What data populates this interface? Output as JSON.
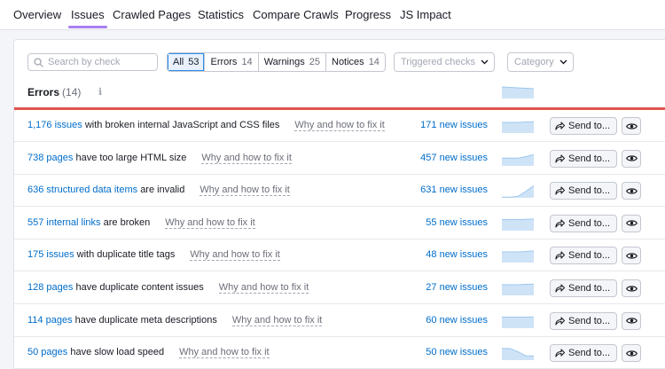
{
  "tabs": [
    {
      "label": "Overview",
      "active": false
    },
    {
      "label": "Issues",
      "active": true
    },
    {
      "label": "Crawled Pages",
      "active": false
    },
    {
      "label": "Statistics",
      "active": false
    },
    {
      "label": "Compare Crawls",
      "active": false
    },
    {
      "label": "Progress",
      "active": false
    },
    {
      "label": "JS Impact",
      "active": false
    }
  ],
  "search": {
    "placeholder": "Search by check"
  },
  "filters": [
    {
      "label": "All",
      "count": "53",
      "active": true
    },
    {
      "label": "Errors",
      "count": "14",
      "active": false
    },
    {
      "label": "Warnings",
      "count": "25",
      "active": false
    },
    {
      "label": "Notices",
      "count": "14",
      "active": false
    }
  ],
  "dropdowns": {
    "triggered": "Triggered checks",
    "category": "Category"
  },
  "section": {
    "title": "Errors",
    "count": "(14)",
    "info_icon": "info-icon"
  },
  "colors": {
    "accent_underline": "#a97ff2",
    "error_line": "#e0534d",
    "link": "#006dca",
    "spark_fill": "#cfe3f7",
    "spark_line": "#9ec8ee"
  },
  "row_buttons": {
    "send_label": "Send to...",
    "send_icon": "share-arrow-icon",
    "eye_icon": "eye-icon"
  },
  "rows": [
    {
      "link": "1,176 issues",
      "text": "with broken internal JavaScript and CSS files",
      "why": "Why and how to fix it",
      "new_issues": "171 new issues",
      "trend": [
        0.75,
        0.75,
        0.75,
        0.78,
        0.8
      ]
    },
    {
      "link": "738 pages",
      "text": "have too large HTML size",
      "why": "Why and how to fix it",
      "new_issues": "457 new issues",
      "trend": [
        0.55,
        0.55,
        0.55,
        0.65,
        0.8
      ]
    },
    {
      "link": "636 structured data items",
      "text": "are invalid",
      "why": "Why and how to fix it",
      "new_issues": "631 new issues",
      "trend": [
        0.05,
        0.05,
        0.1,
        0.45,
        0.85
      ]
    },
    {
      "link": "557 internal links",
      "text": "are broken",
      "why": "Why and how to fix it",
      "new_issues": "55 new issues",
      "trend": [
        0.78,
        0.78,
        0.78,
        0.8,
        0.82
      ]
    },
    {
      "link": "175 issues",
      "text": "with duplicate title tags",
      "why": "Why and how to fix it",
      "new_issues": "48 new issues",
      "trend": [
        0.75,
        0.75,
        0.75,
        0.78,
        0.82
      ]
    },
    {
      "link": "128 pages",
      "text": "have duplicate content issues",
      "why": "Why and how to fix it",
      "new_issues": "27 new issues",
      "trend": [
        0.75,
        0.75,
        0.75,
        0.78,
        0.8
      ]
    },
    {
      "link": "114 pages",
      "text": "have duplicate meta descriptions",
      "why": "Why and how to fix it",
      "new_issues": "60 new issues",
      "trend": [
        0.78,
        0.78,
        0.78,
        0.78,
        0.8
      ]
    },
    {
      "link": "50 pages",
      "text": "have slow load speed",
      "why": "Why and how to fix it",
      "new_issues": "50 new issues",
      "trend": [
        0.82,
        0.82,
        0.6,
        0.3,
        0.3
      ]
    }
  ]
}
